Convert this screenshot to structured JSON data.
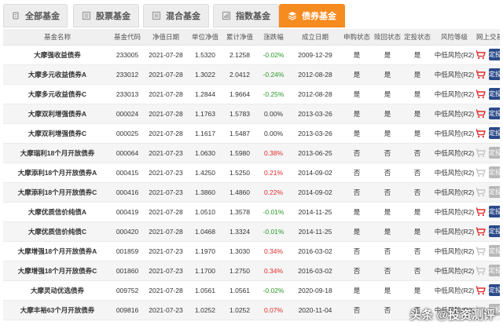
{
  "tabs": [
    {
      "label": "全部基金",
      "icon": "all-funds-icon",
      "active": false
    },
    {
      "label": "股票基金",
      "icon": "stock-icon",
      "active": false
    },
    {
      "label": "混合基金",
      "icon": "mixed-icon",
      "active": false
    },
    {
      "label": "指数基金",
      "icon": "index-icon",
      "active": false
    },
    {
      "label": "债券基金",
      "icon": "bond-icon",
      "active": true
    }
  ],
  "columns": [
    "基金名称",
    "基金代码",
    "净值日期",
    "单位净值",
    "累计净值",
    "涨跌幅",
    "成立日期",
    "申购状态",
    "赎回状态",
    "定投状态",
    "风险等级",
    "网上交易"
  ],
  "rows": [
    {
      "name": "大摩强收益债券",
      "code": "233005",
      "nav_date": "2021-07-28",
      "unit_nav": "1.5320",
      "acc_nav": "2.1258",
      "change": "-0.02%",
      "found_date": "2009-12-29",
      "purchase": "是",
      "redeem": "是",
      "sip": "是",
      "risk": "中低风险(R2)",
      "sip_enabled": true
    },
    {
      "name": "大摩多元收益债券A",
      "code": "233012",
      "nav_date": "2021-07-28",
      "unit_nav": "1.3022",
      "acc_nav": "2.0412",
      "change": "-0.24%",
      "found_date": "2012-08-28",
      "purchase": "是",
      "redeem": "是",
      "sip": "是",
      "risk": "中低风险(R2)",
      "sip_enabled": true
    },
    {
      "name": "大摩多元收益债券C",
      "code": "233013",
      "nav_date": "2021-07-28",
      "unit_nav": "1.2844",
      "acc_nav": "1.9664",
      "change": "-0.25%",
      "found_date": "2012-08-28",
      "purchase": "是",
      "redeem": "是",
      "sip": "是",
      "risk": "中低风险(R2)",
      "sip_enabled": true
    },
    {
      "name": "大摩双利增强债券A",
      "code": "000024",
      "nav_date": "2021-07-28",
      "unit_nav": "1.1763",
      "acc_nav": "1.5783",
      "change": "0.00%",
      "found_date": "2013-03-26",
      "purchase": "是",
      "redeem": "是",
      "sip": "是",
      "risk": "中低风险(R2)",
      "sip_enabled": true
    },
    {
      "name": "大摩双利增强债券C",
      "code": "000025",
      "nav_date": "2021-07-28",
      "unit_nav": "1.1617",
      "acc_nav": "1.5487",
      "change": "0.00%",
      "found_date": "2013-03-26",
      "purchase": "是",
      "redeem": "是",
      "sip": "是",
      "risk": "中低风险(R2)",
      "sip_enabled": true
    },
    {
      "name": "大摩瑞利18个月开放债券",
      "code": "000064",
      "nav_date": "2021-07-23",
      "unit_nav": "1.0630",
      "acc_nav": "1.5980",
      "change": "0.38%",
      "found_date": "2013-06-25",
      "purchase": "否",
      "redeem": "否",
      "sip": "否",
      "risk": "中低风险(R2)",
      "sip_enabled": false
    },
    {
      "name": "大摩添利18个月开放债券A",
      "code": "000415",
      "nav_date": "2021-07-23",
      "unit_nav": "1.4250",
      "acc_nav": "1.5250",
      "change": "0.21%",
      "found_date": "2014-09-02",
      "purchase": "否",
      "redeem": "否",
      "sip": "否",
      "risk": "中低风险(R2)",
      "sip_enabled": false
    },
    {
      "name": "大摩添利18个月开放债券C",
      "code": "000416",
      "nav_date": "2021-07-23",
      "unit_nav": "1.3860",
      "acc_nav": "1.4860",
      "change": "0.22%",
      "found_date": "2014-09-02",
      "purchase": "否",
      "redeem": "否",
      "sip": "否",
      "risk": "中低风险(R2)",
      "sip_enabled": false
    },
    {
      "name": "大摩优质信价纯债A",
      "code": "000419",
      "nav_date": "2021-07-28",
      "unit_nav": "1.0510",
      "acc_nav": "1.3578",
      "change": "-0.01%",
      "found_date": "2014-11-25",
      "purchase": "是",
      "redeem": "是",
      "sip": "是",
      "risk": "中低风险(R2)",
      "sip_enabled": true
    },
    {
      "name": "大摩优质信价纯债C",
      "code": "000420",
      "nav_date": "2021-07-28",
      "unit_nav": "1.0468",
      "acc_nav": "1.3324",
      "change": "-0.01%",
      "found_date": "2014-11-25",
      "purchase": "是",
      "redeem": "是",
      "sip": "是",
      "risk": "中低风险(R2)",
      "sip_enabled": true
    },
    {
      "name": "大摩增强18个月开放债券A",
      "code": "001859",
      "nav_date": "2021-07-23",
      "unit_nav": "1.1970",
      "acc_nav": "1.3030",
      "change": "0.34%",
      "found_date": "2016-03-02",
      "purchase": "否",
      "redeem": "否",
      "sip": "否",
      "risk": "中低风险(R2)",
      "sip_enabled": false
    },
    {
      "name": "大摩增强18个月开放债券C",
      "code": "001860",
      "nav_date": "2021-07-23",
      "unit_nav": "1.1700",
      "acc_nav": "1.2750",
      "change": "0.34%",
      "found_date": "2016-03-02",
      "purchase": "否",
      "redeem": "否",
      "sip": "否",
      "risk": "中低风险(R2)",
      "sip_enabled": false
    },
    {
      "name": "大摩灵动优选债券",
      "code": "009752",
      "nav_date": "2021-07-28",
      "unit_nav": "1.0561",
      "acc_nav": "1.0561",
      "change": "-0.02%",
      "found_date": "2020-09-18",
      "purchase": "是",
      "redeem": "是",
      "sip": "是",
      "risk": "中低风险(R2)",
      "sip_enabled": true
    },
    {
      "name": "大摩丰裕63个月开放债券",
      "code": "009816",
      "nav_date": "2021-07-23",
      "unit_nav": "1.0252",
      "acc_nav": "1.0252",
      "change": "0.07%",
      "found_date": "2020-11-04",
      "purchase": "否",
      "redeem": "否",
      "sip": "否",
      "risk": "中低风险(R2)",
      "sip_enabled": false
    }
  ],
  "trade_button_label": "定投",
  "watermark": "头条 @投资测评",
  "colors": {
    "active_tab": "#f68b1f",
    "up": "#e02b2b",
    "down": "#2a9a2a",
    "cart_active": "#e02b2b",
    "cart_disabled": "#c4c4c4",
    "button_active": "#2b4a8a",
    "button_disabled": "#b8b8b8"
  }
}
